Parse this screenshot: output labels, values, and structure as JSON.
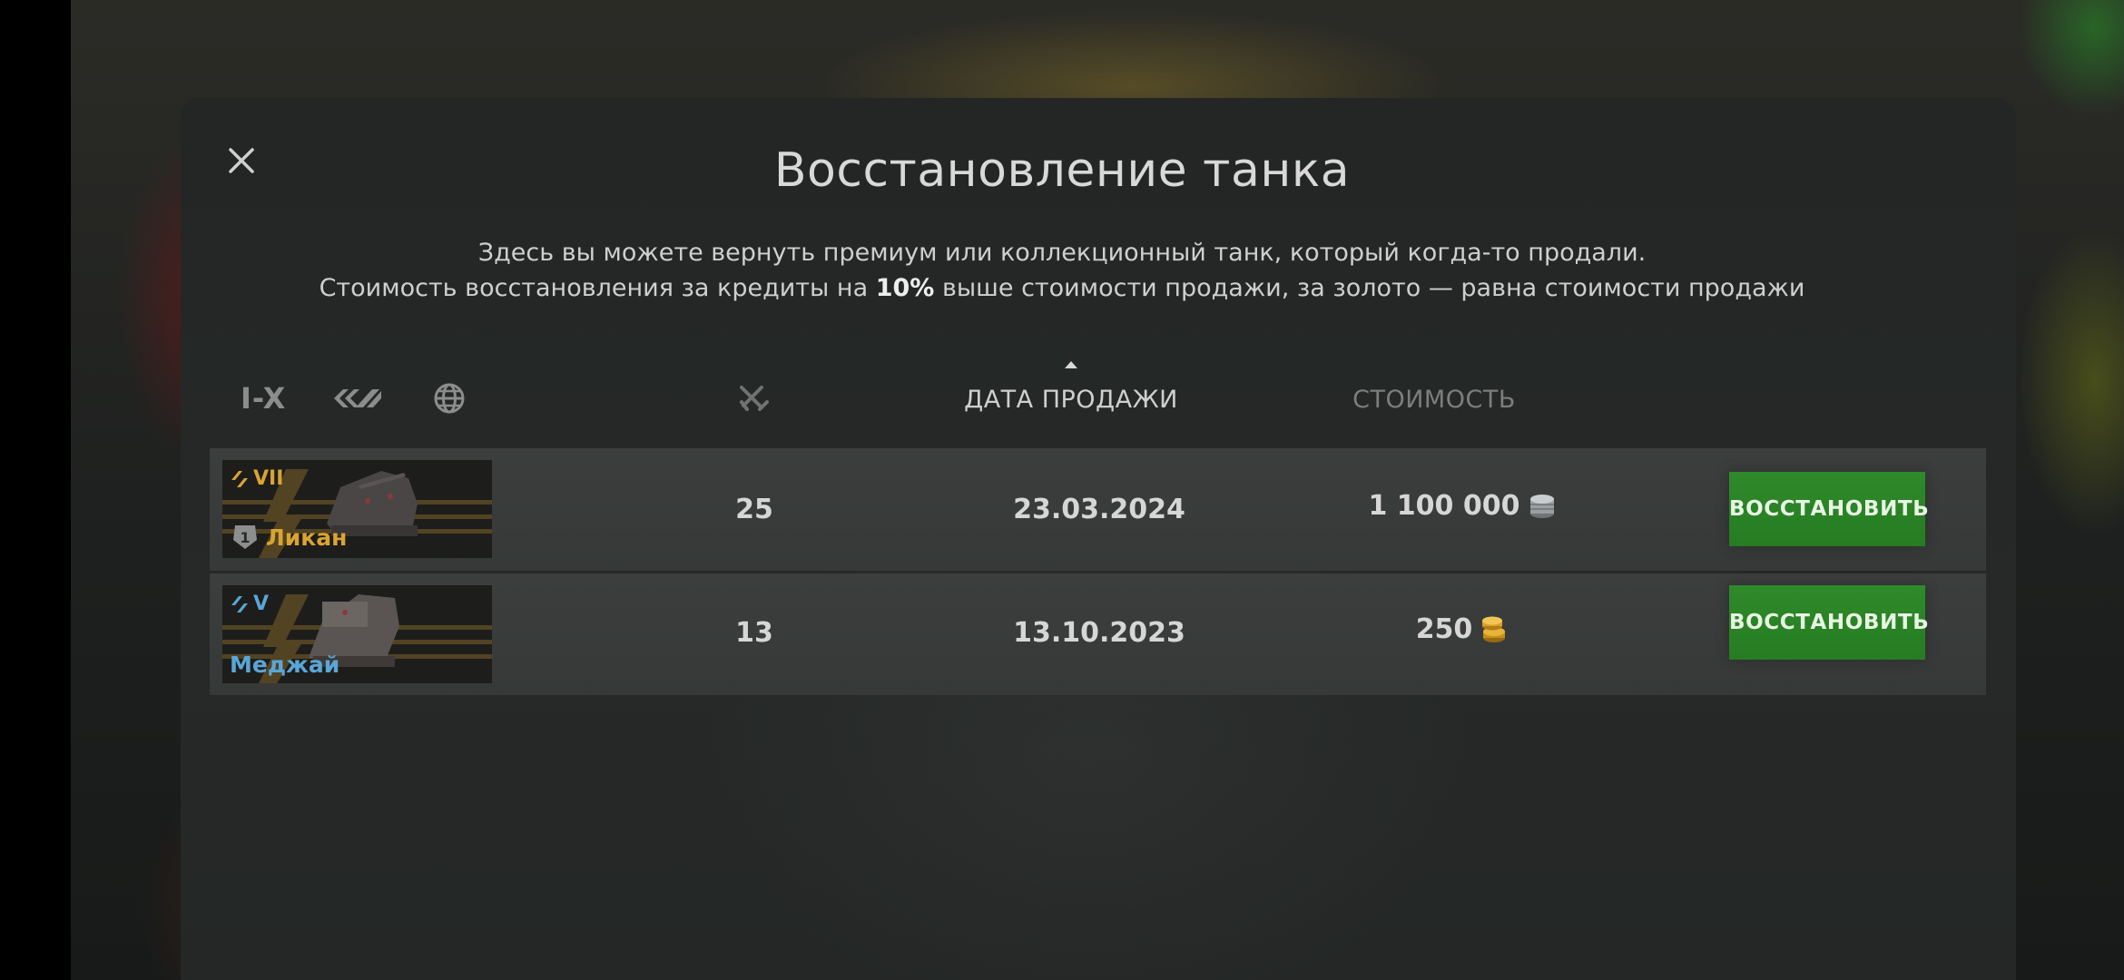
{
  "dialog": {
    "title": "Восстановление танка",
    "description_line1": "Здесь вы можете вернуть премиум или коллекционный танк, который когда-то продали.",
    "description_line2_before": "Стоимость восстановления за кредиты на ",
    "description_line2_bold": "10%",
    "description_line2_after": " выше стоимости продажи, за золото — равна стоимости продажи"
  },
  "filters": {
    "tier_label": "I-X",
    "type_icon": "tank-type-icon",
    "nation_icon": "globe-icon"
  },
  "columns": {
    "battles_icon": "crossed-swords-icon",
    "date_label": "ДАТА ПРОДАЖИ",
    "cost_label": "СТОИМОСТЬ",
    "sorted_by": "date"
  },
  "rows": [
    {
      "tier": "VII",
      "name": "Ликан",
      "name_color": "#d9a431",
      "tier_color": "#d9a431",
      "mastery": "1",
      "battles": "25",
      "date": "23.03.2024",
      "cost": "1 100 000",
      "currency_icon": "credits-icon",
      "button_label": "ВОССТАНОВИТЬ"
    },
    {
      "tier": "V",
      "name": "Меджай",
      "name_color": "#5aa6d6",
      "tier_color": "#5aa6d6",
      "mastery": "",
      "battles": "13",
      "date": "13.10.2023",
      "cost": "250",
      "currency_icon": "gold-icon",
      "button_label": "ВОССТАНОВИТЬ"
    }
  ],
  "colors": {
    "accent_green": "#2f8a2a",
    "premium_gold": "#d9a431",
    "collector_blue": "#5aa6d6"
  }
}
